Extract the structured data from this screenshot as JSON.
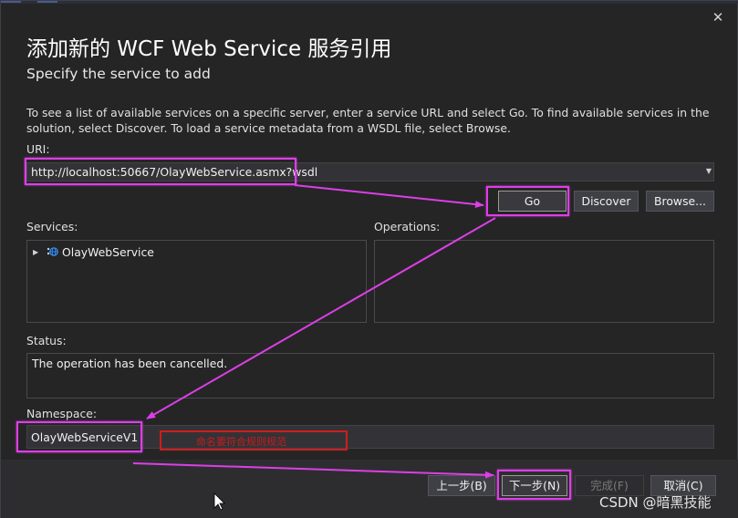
{
  "dialog": {
    "title": "添加新的 WCF Web Service 服务引用",
    "subtitle": "Specify the service to add",
    "instructions": "To see a list of available services on a specific server, enter a service URL and select Go. To find available services in the solution, select Discover.  To load a service metadata from a WSDL file, select Browse.",
    "close_glyph": "✕"
  },
  "uri": {
    "label": "URI:",
    "value": "http://localhost:50667/OlayWebService.asmx?wsdl"
  },
  "buttons": {
    "go": "Go",
    "discover": "Discover",
    "browse": "Browse..."
  },
  "services": {
    "label": "Services:",
    "items": [
      {
        "label": "OlayWebService",
        "icon": "globe-icon"
      }
    ]
  },
  "operations": {
    "label": "Operations:"
  },
  "status": {
    "label": "Status:",
    "text": "The operation has been cancelled."
  },
  "namespace": {
    "label": "Namespace:",
    "value": "OlayWebServiceV1",
    "annotation": "命名要符合规则规范"
  },
  "footer": {
    "previous": "上一步(B)",
    "next": "下一步(N)",
    "finish": "完成(F)",
    "cancel": "取消(C)"
  },
  "watermark": "CSDN @暗黑技能",
  "colors": {
    "highlight": "#dc3fe6",
    "note_border": "#d11c1c",
    "background": "#252526"
  }
}
